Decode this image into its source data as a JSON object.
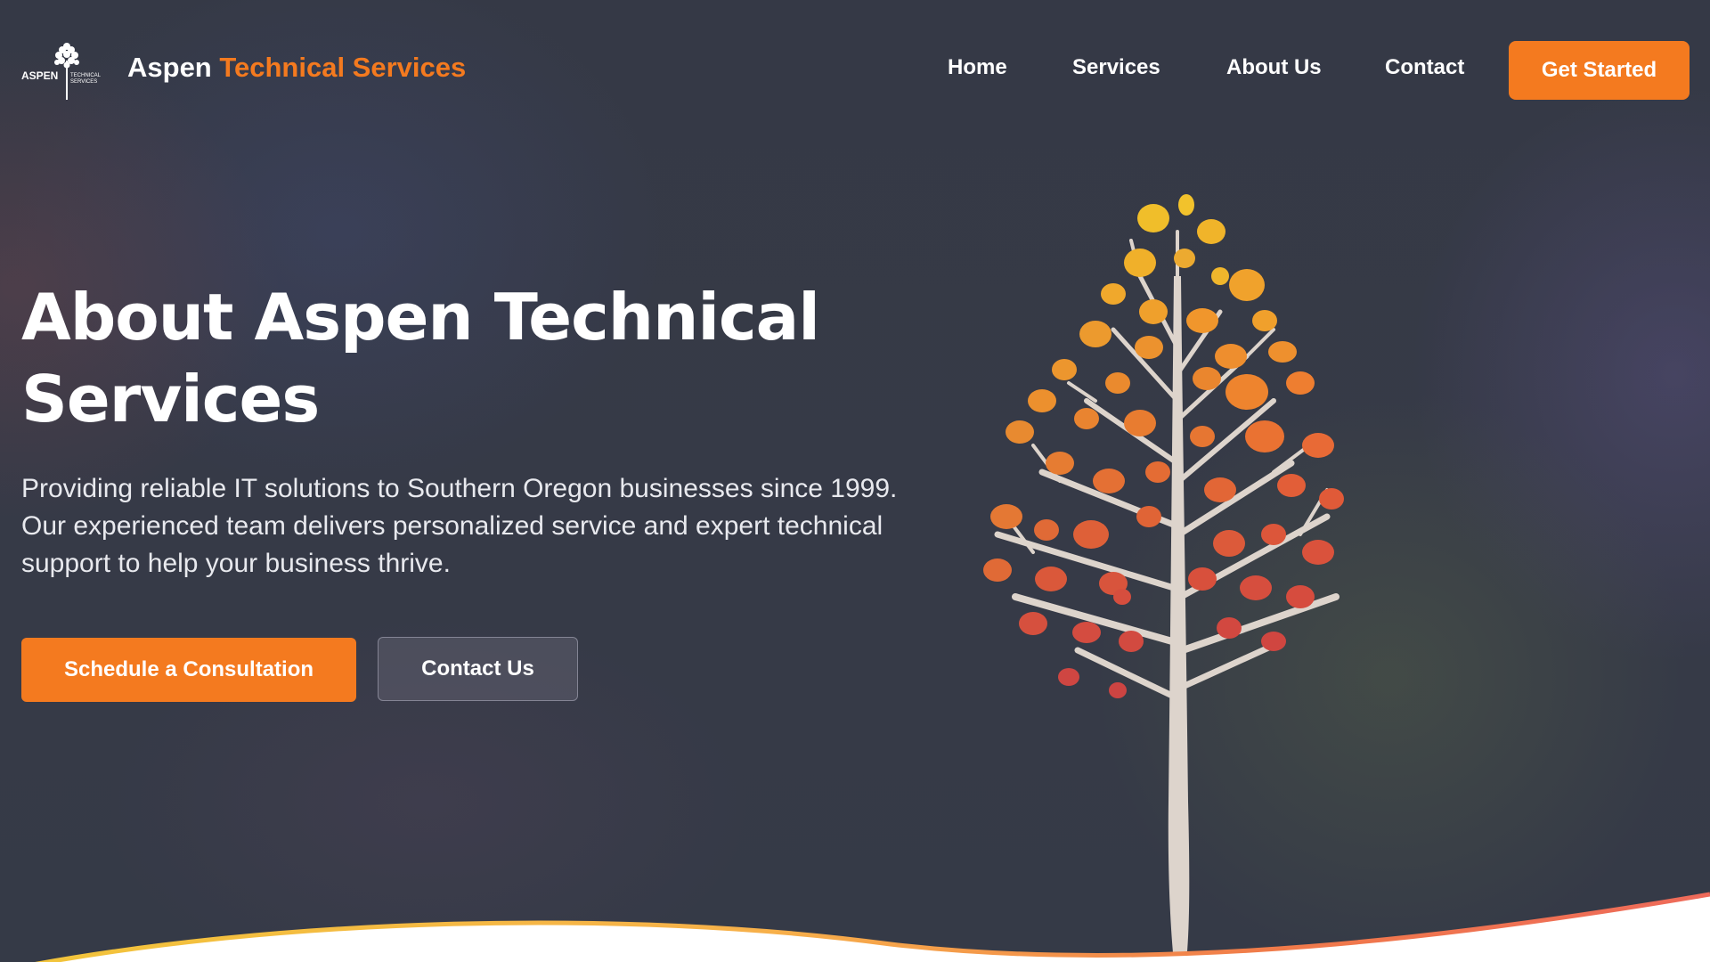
{
  "header": {
    "logo": {
      "icon": "aspen-tree-logo-icon",
      "wordmark": "ASPEN",
      "sub_line1": "TECHNICAL",
      "sub_line2": "SERVICES"
    },
    "brand_primary": "Aspen",
    "brand_accent": "Technical Services",
    "nav": [
      "Home",
      "Services",
      "About Us",
      "Contact"
    ],
    "cta_label": "Get Started"
  },
  "hero": {
    "title": "About Aspen Technical Services",
    "description": "Providing reliable IT solutions to Southern Oregon businesses since 1999. Our experienced team delivers personalized service and expert technical support to help your business thrive.",
    "primary_button": "Schedule a Consultation",
    "secondary_button": "Contact Us",
    "illustration_icon": "aspen-tree-illustration"
  },
  "colors": {
    "background": "#353946",
    "accent": "#f47a1f",
    "text": "#ffffff",
    "secondary_button_bg": "#52535f"
  }
}
